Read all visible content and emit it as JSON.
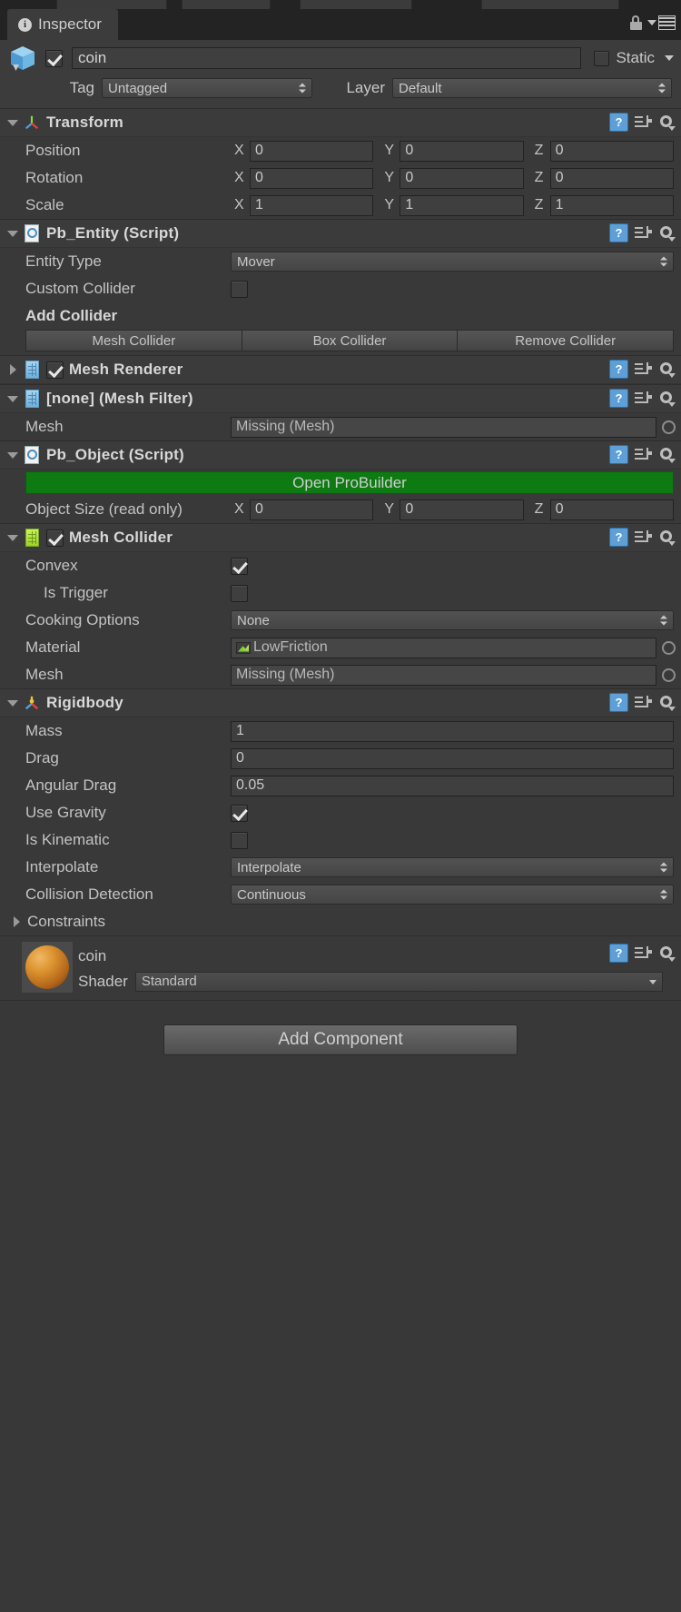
{
  "window": {
    "tab_label": "Inspector",
    "tab_icon": "info-icon",
    "lock_icon": "lock-icon",
    "menu_icon": "hamburger-menu-icon"
  },
  "object_header": {
    "enabled": true,
    "name": "coin",
    "static_label": "Static",
    "static_checked": false,
    "tag_label": "Tag",
    "tag_value": "Untagged",
    "layer_label": "Layer",
    "layer_value": "Default"
  },
  "components": [
    {
      "id": "transform",
      "title": "Transform",
      "icon": "transform-axis-icon",
      "expanded": true,
      "has_toggle": false,
      "vectors": [
        {
          "label": "Position",
          "x": "0",
          "y": "0",
          "z": "0"
        },
        {
          "label": "Rotation",
          "x": "0",
          "y": "0",
          "z": "0"
        },
        {
          "label": "Scale",
          "x": "1",
          "y": "1",
          "z": "1"
        }
      ]
    },
    {
      "id": "pb_entity",
      "title": "Pb_Entity (Script)",
      "icon": "script-icon",
      "expanded": true,
      "has_toggle": false,
      "entity_type_label": "Entity Type",
      "entity_type_value": "Mover",
      "custom_collider_label": "Custom Collider",
      "custom_collider_checked": false,
      "add_collider_label": "Add Collider",
      "buttons": [
        "Mesh Collider",
        "Box Collider",
        "Remove Collider"
      ]
    },
    {
      "id": "mesh_renderer",
      "title": "Mesh Renderer",
      "icon": "mesh-renderer-icon",
      "expanded": false,
      "has_toggle": true,
      "enabled": true
    },
    {
      "id": "mesh_filter",
      "title": "[none] (Mesh Filter)",
      "icon": "mesh-filter-icon",
      "expanded": true,
      "has_toggle": false,
      "mesh_label": "Mesh",
      "mesh_value": "Missing (Mesh)"
    },
    {
      "id": "pb_object",
      "title": "Pb_Object (Script)",
      "icon": "script-icon",
      "expanded": true,
      "has_toggle": false,
      "open_probuilder_label": "Open ProBuilder",
      "open_probuilder_color": "#0d7a12",
      "object_size_label": "Object Size (read only)",
      "object_size": {
        "x": "0",
        "y": "0",
        "z": "0"
      }
    },
    {
      "id": "mesh_collider",
      "title": "Mesh Collider",
      "icon": "mesh-collider-icon",
      "expanded": true,
      "has_toggle": true,
      "enabled": true,
      "convex_label": "Convex",
      "convex_checked": true,
      "is_trigger_label": "Is Trigger",
      "is_trigger_checked": false,
      "cooking_options_label": "Cooking Options",
      "cooking_options_value": "None",
      "material_label": "Material",
      "material_value": "LowFriction",
      "mesh_label": "Mesh",
      "mesh_value": "Missing (Mesh)"
    },
    {
      "id": "rigidbody",
      "title": "Rigidbody",
      "icon": "rigidbody-icon",
      "expanded": true,
      "has_toggle": false,
      "mass_label": "Mass",
      "mass_value": "1",
      "drag_label": "Drag",
      "drag_value": "0",
      "angular_drag_label": "Angular Drag",
      "angular_drag_value": "0.05",
      "use_gravity_label": "Use Gravity",
      "use_gravity_checked": true,
      "is_kinematic_label": "Is Kinematic",
      "is_kinematic_checked": false,
      "interpolate_label": "Interpolate",
      "interpolate_value": "Interpolate",
      "collision_detection_label": "Collision Detection",
      "collision_detection_value": "Continuous",
      "constraints_label": "Constraints",
      "constraints_expanded": false
    }
  ],
  "material_preview": {
    "name": "coin",
    "shader_label": "Shader",
    "shader_value": "Standard",
    "sphere_color": "#d89330"
  },
  "footer": {
    "add_component_label": "Add Component"
  },
  "icons": {
    "help": "?",
    "info": "i"
  }
}
